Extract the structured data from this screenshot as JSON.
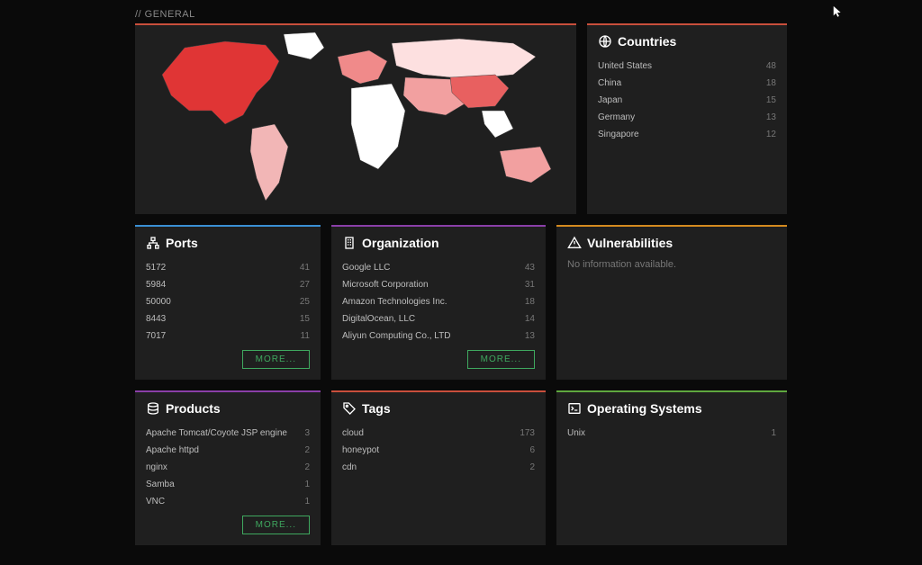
{
  "section_label": "// GENERAL",
  "cards": {
    "countries": {
      "title": "Countries",
      "items": [
        {
          "label": "United States",
          "count": 48
        },
        {
          "label": "China",
          "count": 18
        },
        {
          "label": "Japan",
          "count": 15
        },
        {
          "label": "Germany",
          "count": 13
        },
        {
          "label": "Singapore",
          "count": 12
        }
      ]
    },
    "ports": {
      "title": "Ports",
      "items": [
        {
          "label": "5172",
          "count": 41
        },
        {
          "label": "5984",
          "count": 27
        },
        {
          "label": "50000",
          "count": 25
        },
        {
          "label": "8443",
          "count": 15
        },
        {
          "label": "7017",
          "count": 11
        }
      ],
      "more": "MORE..."
    },
    "organization": {
      "title": "Organization",
      "items": [
        {
          "label": "Google LLC",
          "count": 43
        },
        {
          "label": "Microsoft Corporation",
          "count": 31
        },
        {
          "label": "Amazon Technologies Inc.",
          "count": 18
        },
        {
          "label": "DigitalOcean, LLC",
          "count": 14
        },
        {
          "label": "Aliyun Computing Co., LTD",
          "count": 13
        }
      ],
      "more": "MORE..."
    },
    "vulnerabilities": {
      "title": "Vulnerabilities",
      "empty": "No information available."
    },
    "products": {
      "title": "Products",
      "items": [
        {
          "label": "Apache Tomcat/Coyote JSP engine",
          "count": 3
        },
        {
          "label": "Apache httpd",
          "count": 2
        },
        {
          "label": "nginx",
          "count": 2
        },
        {
          "label": "Samba",
          "count": 1
        },
        {
          "label": "VNC",
          "count": 1
        }
      ],
      "more": "MORE..."
    },
    "tags": {
      "title": "Tags",
      "items": [
        {
          "label": "cloud",
          "count": 173
        },
        {
          "label": "honeypot",
          "count": 6
        },
        {
          "label": "cdn",
          "count": 2
        }
      ]
    },
    "os": {
      "title": "Operating Systems",
      "items": [
        {
          "label": "Unix",
          "count": 1
        }
      ]
    }
  }
}
